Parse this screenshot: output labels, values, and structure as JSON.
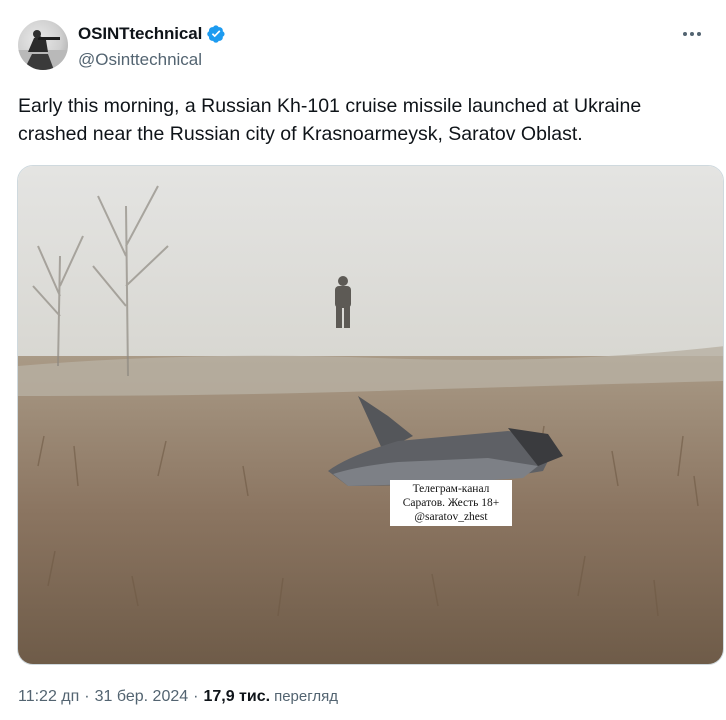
{
  "author": {
    "display_name": "OSINTtechnical",
    "handle": "@Osinttechnical",
    "verified_color": "#1d9bf0"
  },
  "tweet": {
    "text": "Early this morning, a Russian Kh-101 cruise missile launched at Ukraine\ncrashed near the Russian city of Krasnoarmeysk, Saratov Oblast."
  },
  "media": {
    "watermark_lines": [
      "Телеграм-канал",
      "Саратов. Жесть 18+",
      "@saratov_zhest"
    ]
  },
  "meta": {
    "time": "11:22 дп",
    "separator": "·",
    "date": "31 бер. 2024",
    "views_count": "17,9 тис.",
    "views_label": "перегляд"
  },
  "icons": {
    "more": "more-horizontal-icon",
    "verified": "verified-badge-icon"
  }
}
